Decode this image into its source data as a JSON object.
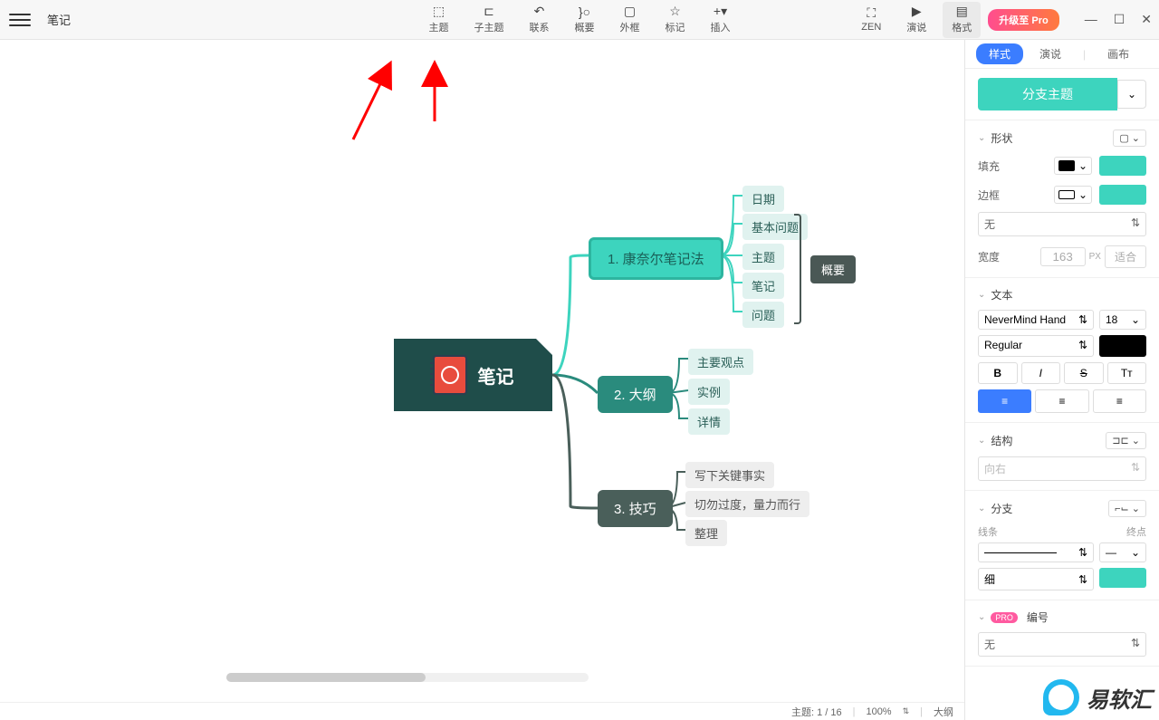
{
  "app": {
    "title": "笔记"
  },
  "toolbar": {
    "items": [
      {
        "label": "主题",
        "icon": "⬚"
      },
      {
        "label": "子主题",
        "icon": "⊏"
      },
      {
        "label": "联系",
        "icon": "↶"
      },
      {
        "label": "概要",
        "icon": "}○"
      },
      {
        "label": "外框",
        "icon": "▢"
      },
      {
        "label": "标记",
        "icon": "☆"
      },
      {
        "label": "插入",
        "icon": "+▾"
      }
    ],
    "right": [
      {
        "label": "ZEN",
        "icon": "⛶"
      },
      {
        "label": "演说",
        "icon": "▶"
      },
      {
        "label": "格式",
        "icon": "▤",
        "active": true
      }
    ],
    "upgrade": "升级至 Pro"
  },
  "mindmap": {
    "root": "笔记",
    "branches": [
      {
        "label": "1. 康奈尔笔记法",
        "children": [
          "日期",
          "基本问题",
          "主题",
          "笔记",
          "问题"
        ]
      },
      {
        "label": "2. 大纲",
        "children": [
          "主要观点",
          "实例",
          "详情"
        ]
      },
      {
        "label": "3. 技巧",
        "children": [
          "写下关键事实",
          "切勿过度，量力而行",
          "整理"
        ]
      }
    ],
    "summary": "概要"
  },
  "panel": {
    "tabs": [
      "样式",
      "演说",
      "画布"
    ],
    "branch_theme": "分支主题",
    "sections": {
      "shape": {
        "title": "形状",
        "fill": "填充",
        "border": "边框",
        "border_style": "无",
        "width": "宽度",
        "width_val": "163",
        "width_unit": "PX",
        "fit": "适合"
      },
      "text": {
        "title": "文本",
        "font": "NeverMind Hand",
        "size": "18",
        "weight": "Regular",
        "styles": [
          "B",
          "I",
          "S",
          "Tт"
        ]
      },
      "structure": {
        "title": "结构",
        "direction": "向右"
      },
      "branch": {
        "title": "分支",
        "line": "线条",
        "end": "终点",
        "thickness": "细"
      },
      "number": {
        "title": "编号",
        "value": "无"
      }
    }
  },
  "status": {
    "topic": "主题: 1 / 16",
    "zoom": "100%",
    "view": "大纲"
  },
  "watermark": "易软汇"
}
